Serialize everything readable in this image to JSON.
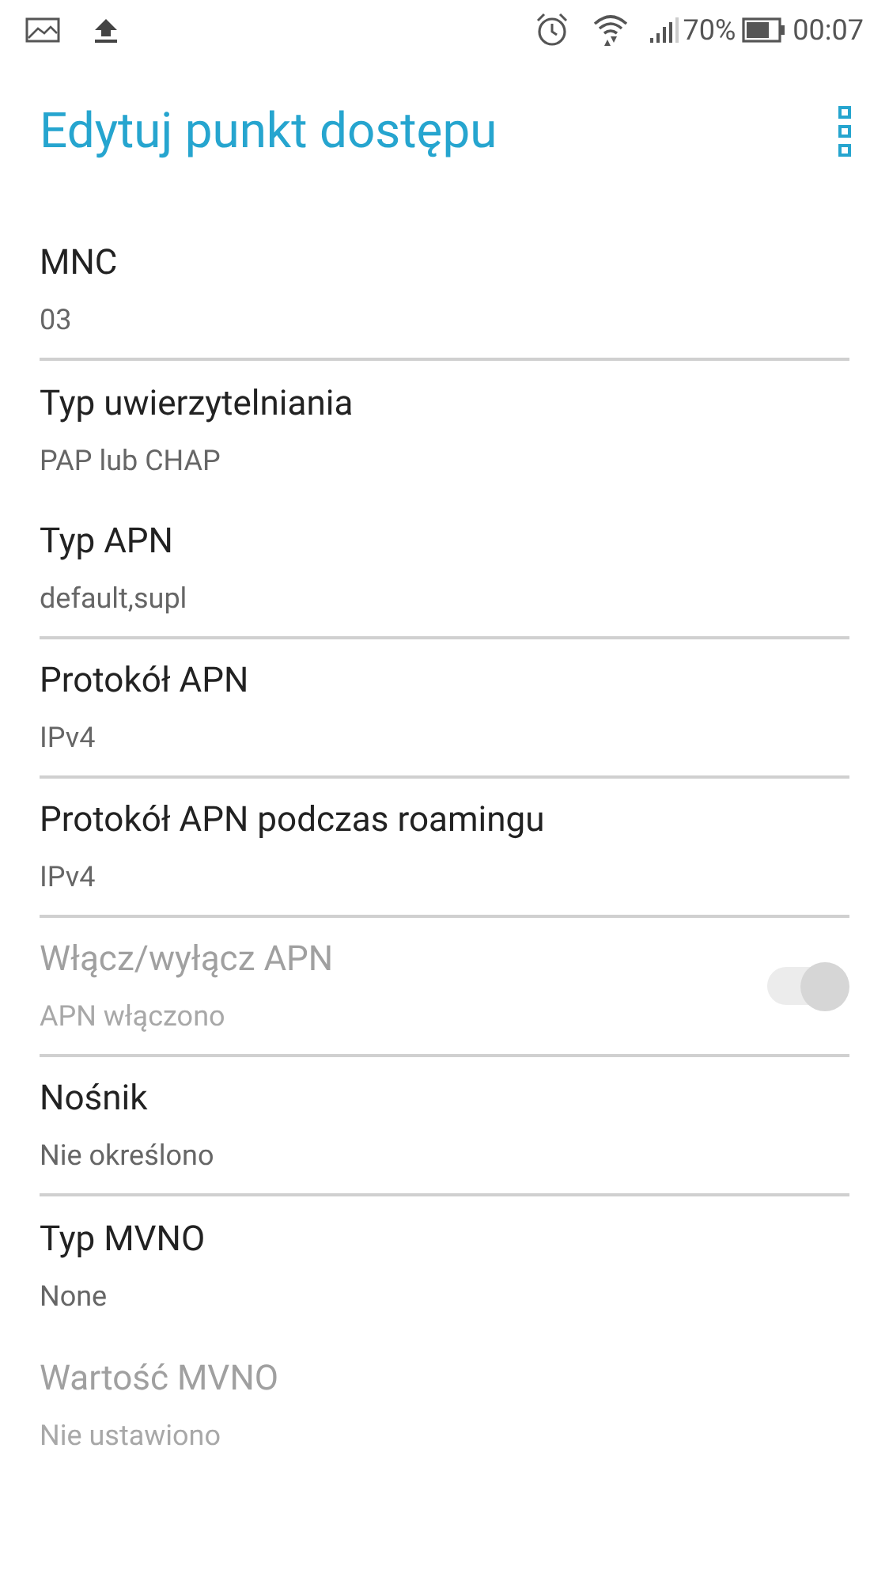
{
  "status_bar": {
    "battery": "70%",
    "time": "00:07"
  },
  "title": "Edytuj punkt dostępu",
  "rows": [
    {
      "kind": "text",
      "title": "MNC",
      "value": "03",
      "disabled": false,
      "divider": true
    },
    {
      "kind": "text",
      "title": "Typ uwierzytelniania",
      "value": "PAP lub CHAP",
      "disabled": false,
      "divider": false
    },
    {
      "kind": "text",
      "title": "Typ APN",
      "value": "default,supl",
      "disabled": false,
      "divider": true
    },
    {
      "kind": "text",
      "title": "Protokół APN",
      "value": "IPv4",
      "disabled": false,
      "divider": true
    },
    {
      "kind": "text",
      "title": "Protokół APN podczas roamingu",
      "value": "IPv4",
      "disabled": false,
      "divider": true
    },
    {
      "kind": "switch",
      "title": "Włącz/wyłącz APN",
      "value": "APN włączono",
      "disabled": true,
      "on": true,
      "divider": true
    },
    {
      "kind": "text",
      "title": "Nośnik",
      "value": "Nie określono",
      "disabled": false,
      "divider": true
    },
    {
      "kind": "text",
      "title": "Typ MVNO",
      "value": "None",
      "disabled": false,
      "divider": false
    },
    {
      "kind": "text",
      "title": "Wartość MVNO",
      "value": "Nie ustawiono",
      "disabled": true,
      "divider": false
    }
  ]
}
